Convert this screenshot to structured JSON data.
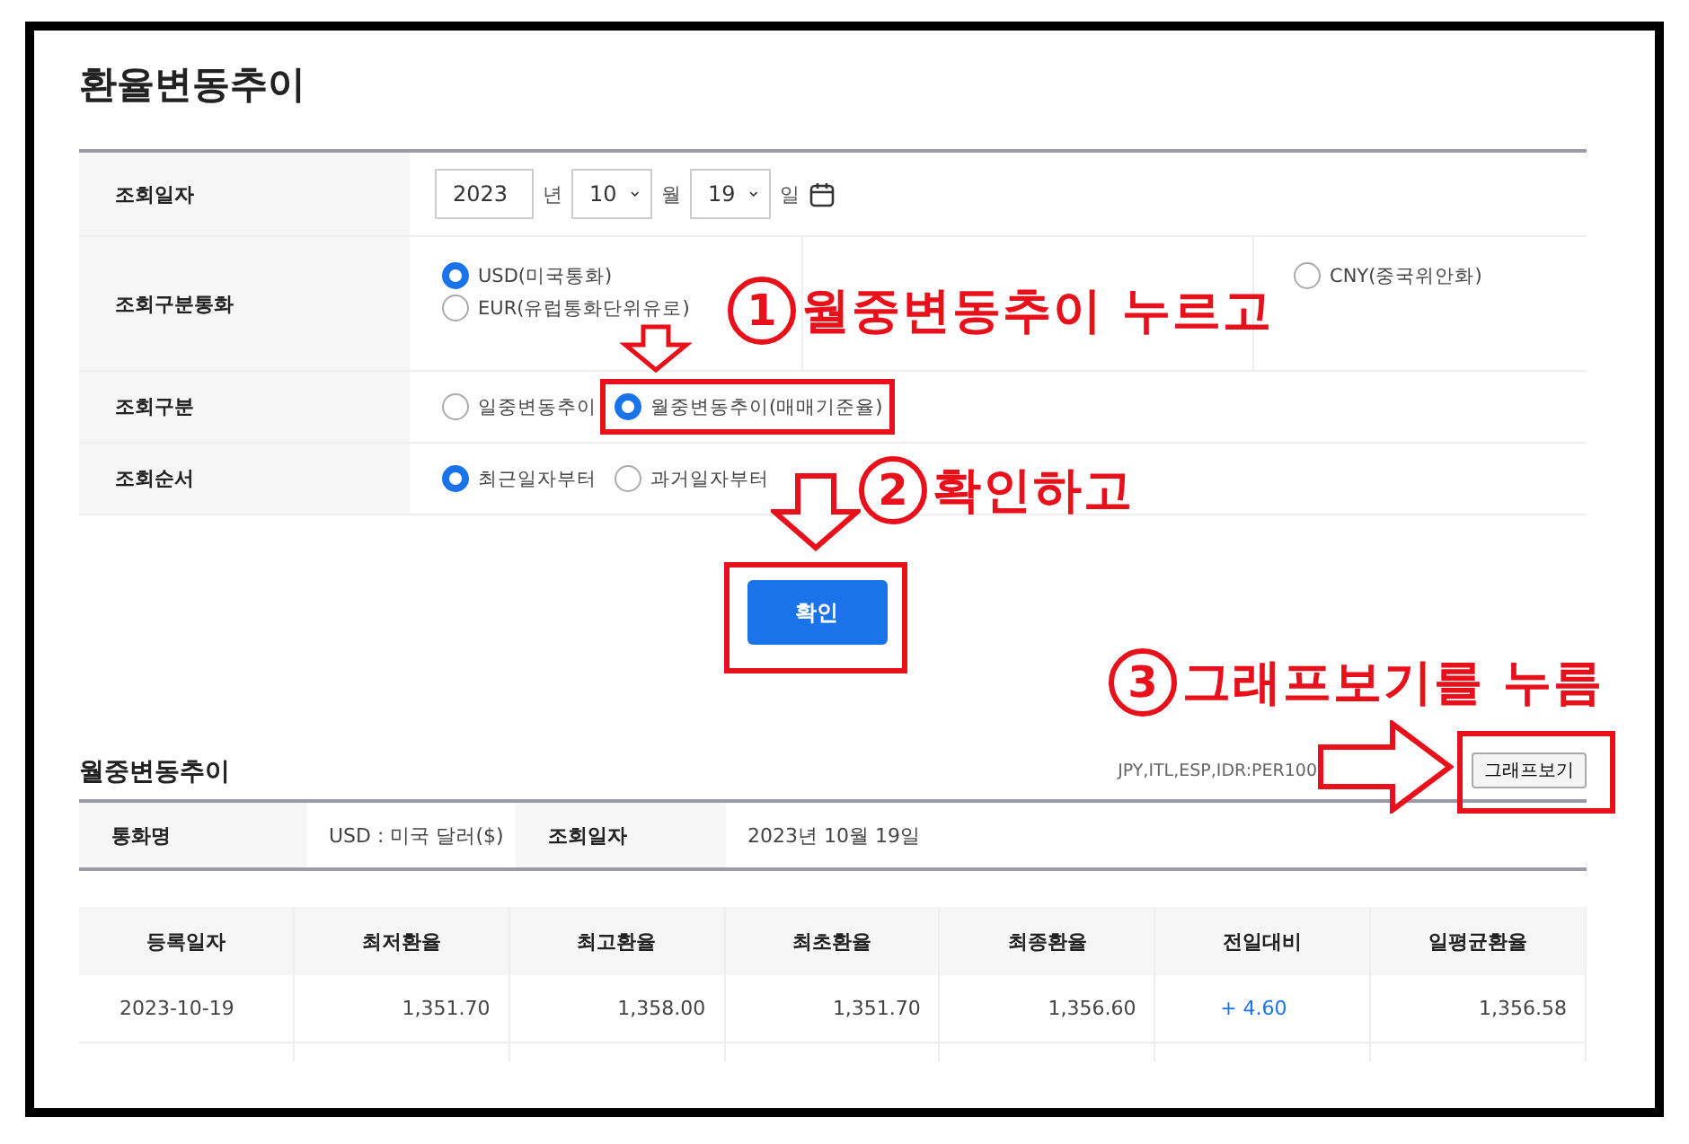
{
  "page_title": "환율변동추이",
  "search_form": {
    "rows": [
      {
        "kind": "date",
        "label": "조회일자",
        "year": "2023",
        "year_unit": "년",
        "month": "10",
        "month_unit": "월",
        "day": "19",
        "day_unit": "일"
      },
      {
        "kind": "currency",
        "label": "조회구분통화",
        "options": [
          {
            "label": "USD(미국통화)",
            "selected": true
          },
          {
            "label": "EUR(유럽통화단위유로)",
            "selected": false
          },
          {
            "label": "CNY(중국위안화)",
            "selected": false
          }
        ]
      },
      {
        "kind": "radio",
        "label": "조회구분",
        "options": [
          {
            "label": "일중변동추이",
            "selected": false
          },
          {
            "label": "월중변동추이(매매기준율)",
            "selected": true
          }
        ]
      },
      {
        "kind": "radio",
        "label": "조회순서",
        "options": [
          {
            "label": "최근일자부터",
            "selected": true
          },
          {
            "label": "과거일자부터",
            "selected": false
          }
        ]
      }
    ],
    "submit": "확인"
  },
  "result": {
    "title": "월중변동추이",
    "note": "JPY,ITL,ESP,IDR:PER100",
    "graph_button": "그래프보기",
    "info": [
      {
        "label": "통화명",
        "value": "USD : 미국 달러($)"
      },
      {
        "label": "조회일자",
        "value": "2023년 10월 19일"
      }
    ],
    "table": {
      "columns": [
        "등록일자",
        "최저환율",
        "최고환율",
        "최초환율",
        "최종환율",
        "전일대비",
        "일평균환율"
      ],
      "rows": [
        [
          "2023-10-19",
          "1,351.70",
          "1,358.00",
          "1,351.70",
          "1,356.60",
          "+ 4.60",
          "1,356.58"
        ]
      ]
    }
  },
  "annotations": [
    {
      "number": "1",
      "text": "월중변동추이 누르고"
    },
    {
      "number": "2",
      "text": "확인하고"
    },
    {
      "number": "3",
      "text": "그래프보기를 누름"
    }
  ]
}
